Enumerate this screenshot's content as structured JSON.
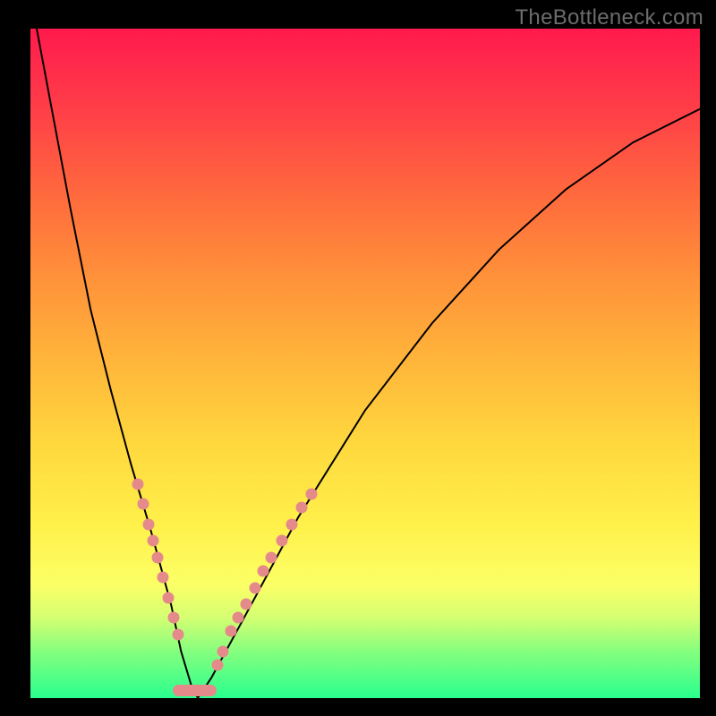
{
  "watermark": "TheBottleneck.com",
  "chart_data": {
    "type": "line",
    "title": "",
    "xlabel": "",
    "ylabel": "",
    "xlim": [
      0,
      100
    ],
    "ylim": [
      0,
      100
    ],
    "series": [
      {
        "name": "v-curve",
        "x": [
          0,
          3,
          6,
          9,
          12,
          15,
          18,
          21,
          22.5,
          24,
          25,
          27,
          33,
          40,
          50,
          60,
          70,
          80,
          90,
          100
        ],
        "values": [
          105,
          89,
          73,
          58,
          46,
          35,
          25,
          14,
          7,
          2,
          0,
          3,
          14,
          27,
          43,
          56,
          67,
          76,
          83,
          88
        ]
      }
    ],
    "markers_left": [
      {
        "x": 16.0,
        "y": 32
      },
      {
        "x": 16.8,
        "y": 29
      },
      {
        "x": 17.6,
        "y": 26
      },
      {
        "x": 18.3,
        "y": 23.5
      },
      {
        "x": 19.0,
        "y": 21
      },
      {
        "x": 19.8,
        "y": 18
      },
      {
        "x": 20.6,
        "y": 15
      },
      {
        "x": 21.4,
        "y": 12
      },
      {
        "x": 22.0,
        "y": 9.5
      }
    ],
    "markers_right": [
      {
        "x": 28.0,
        "y": 5
      },
      {
        "x": 28.8,
        "y": 7
      },
      {
        "x": 30.0,
        "y": 10
      },
      {
        "x": 31.0,
        "y": 12
      },
      {
        "x": 32.2,
        "y": 14
      },
      {
        "x": 33.5,
        "y": 16.5
      },
      {
        "x": 34.8,
        "y": 19
      },
      {
        "x": 36.0,
        "y": 21
      },
      {
        "x": 37.5,
        "y": 23.5
      },
      {
        "x": 39.0,
        "y": 26
      },
      {
        "x": 40.5,
        "y": 28.5
      },
      {
        "x": 42.0,
        "y": 30.5
      }
    ],
    "bottom_segment": {
      "x0": 22.0,
      "x1": 27.0,
      "y": 1.2
    }
  }
}
